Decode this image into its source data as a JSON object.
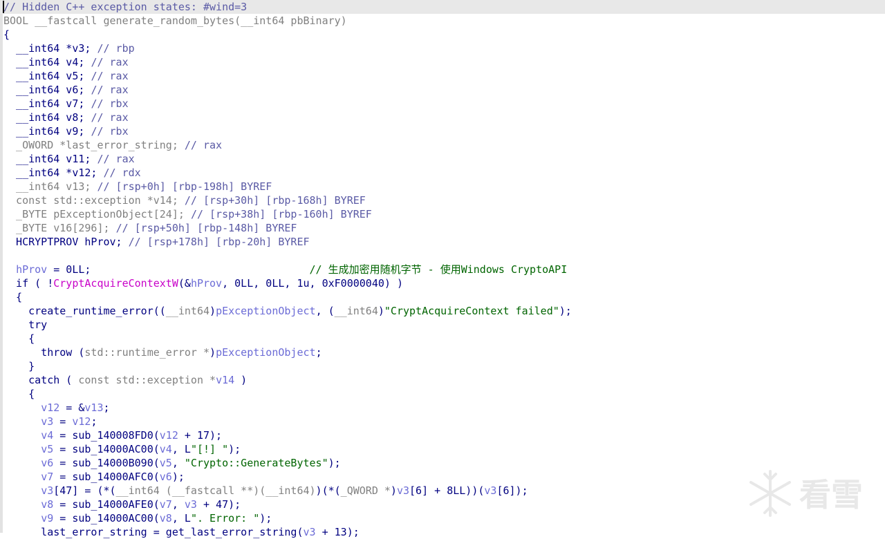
{
  "editor": {
    "lines": [
      [
        {
          "t": "// Hidden C++ exception states: #wind=3",
          "c": "cmt"
        }
      ],
      [
        {
          "t": "BOOL __fastcall generate_random_bytes(__int64 pbBinary)",
          "c": "gray"
        }
      ],
      [
        {
          "t": "{",
          "c": "plain"
        }
      ],
      [
        {
          "t": "  __int64 *v3; ",
          "c": "plain"
        },
        {
          "t": "// rbp",
          "c": "cmt"
        }
      ],
      [
        {
          "t": "  __int64 v4; ",
          "c": "plain"
        },
        {
          "t": "// rax",
          "c": "cmt"
        }
      ],
      [
        {
          "t": "  __int64 v5; ",
          "c": "plain"
        },
        {
          "t": "// rax",
          "c": "cmt"
        }
      ],
      [
        {
          "t": "  __int64 v6; ",
          "c": "plain"
        },
        {
          "t": "// rax",
          "c": "cmt"
        }
      ],
      [
        {
          "t": "  __int64 v7; ",
          "c": "plain"
        },
        {
          "t": "// rbx",
          "c": "cmt"
        }
      ],
      [
        {
          "t": "  __int64 v8; ",
          "c": "plain"
        },
        {
          "t": "// rax",
          "c": "cmt"
        }
      ],
      [
        {
          "t": "  __int64 v9; ",
          "c": "plain"
        },
        {
          "t": "// rbx",
          "c": "cmt"
        }
      ],
      [
        {
          "t": "  _OWORD *last_error_string; ",
          "c": "gray"
        },
        {
          "t": "// rax",
          "c": "cmt"
        }
      ],
      [
        {
          "t": "  __int64 v11; ",
          "c": "plain"
        },
        {
          "t": "// rax",
          "c": "cmt"
        }
      ],
      [
        {
          "t": "  __int64 *v12; ",
          "c": "plain"
        },
        {
          "t": "// rdx",
          "c": "cmt"
        }
      ],
      [
        {
          "t": "  __int64 v13; ",
          "c": "gray"
        },
        {
          "t": "// [rsp+0h] [rbp-198h] BYREF",
          "c": "cmt"
        }
      ],
      [
        {
          "t": "  const std::exception *v14; ",
          "c": "gray"
        },
        {
          "t": "// [rsp+30h] [rbp-168h] BYREF",
          "c": "cmt"
        }
      ],
      [
        {
          "t": "  _BYTE pExceptionObject[24]; ",
          "c": "gray"
        },
        {
          "t": "// [rsp+38h] [rbp-160h] BYREF",
          "c": "cmt"
        }
      ],
      [
        {
          "t": "  _BYTE v16[296]; ",
          "c": "gray"
        },
        {
          "t": "// [rsp+50h] [rbp-148h] BYREF",
          "c": "cmt"
        }
      ],
      [
        {
          "t": "  HCRYPTPROV hProv; ",
          "c": "plain"
        },
        {
          "t": "// [rsp+178h] [rbp-20h] BYREF",
          "c": "cmt"
        }
      ],
      [],
      [
        {
          "t": "  ",
          "c": "plain"
        },
        {
          "t": "hProv",
          "c": "var"
        },
        {
          "t": " = 0LL;                                   ",
          "c": "plain"
        },
        {
          "t": "// 生成加密用随机字节 - 使用Windows CryptoAPI",
          "c": "cmtg"
        }
      ],
      [
        {
          "t": "  if ( !",
          "c": "plain"
        },
        {
          "t": "CryptAcquireContextW",
          "c": "fn"
        },
        {
          "t": "(&",
          "c": "plain"
        },
        {
          "t": "hProv",
          "c": "var"
        },
        {
          "t": ", 0LL, 0LL, 1u, 0xF0000040) )",
          "c": "plain"
        }
      ],
      [
        {
          "t": "  {",
          "c": "plain"
        }
      ],
      [
        {
          "t": "    create_runtime_error((",
          "c": "plain"
        },
        {
          "t": "__int64",
          "c": "gray"
        },
        {
          "t": ")",
          "c": "plain"
        },
        {
          "t": "pExceptionObject",
          "c": "var"
        },
        {
          "t": ", (",
          "c": "plain"
        },
        {
          "t": "__int64",
          "c": "gray"
        },
        {
          "t": ")",
          "c": "plain"
        },
        {
          "t": "\"CryptAcquireContext failed\"",
          "c": "str"
        },
        {
          "t": ");",
          "c": "plain"
        }
      ],
      [
        {
          "t": "    try",
          "c": "plain"
        }
      ],
      [
        {
          "t": "    {",
          "c": "plain"
        }
      ],
      [
        {
          "t": "      throw (",
          "c": "plain"
        },
        {
          "t": "std::runtime_error *",
          "c": "gray"
        },
        {
          "t": ")",
          "c": "plain"
        },
        {
          "t": "pExceptionObject",
          "c": "var"
        },
        {
          "t": ";",
          "c": "plain"
        }
      ],
      [
        {
          "t": "    }",
          "c": "plain"
        }
      ],
      [
        {
          "t": "    catch ( ",
          "c": "plain"
        },
        {
          "t": "const std::exception *",
          "c": "gray"
        },
        {
          "t": "v14",
          "c": "var"
        },
        {
          "t": " )",
          "c": "plain"
        }
      ],
      [
        {
          "t": "    {",
          "c": "plain"
        }
      ],
      [
        {
          "t": "      ",
          "c": "plain"
        },
        {
          "t": "v12",
          "c": "var"
        },
        {
          "t": " = &",
          "c": "plain"
        },
        {
          "t": "v13",
          "c": "var"
        },
        {
          "t": ";",
          "c": "plain"
        }
      ],
      [
        {
          "t": "      ",
          "c": "plain"
        },
        {
          "t": "v3",
          "c": "var"
        },
        {
          "t": " = ",
          "c": "plain"
        },
        {
          "t": "v12",
          "c": "var"
        },
        {
          "t": ";",
          "c": "plain"
        }
      ],
      [
        {
          "t": "      ",
          "c": "plain"
        },
        {
          "t": "v4",
          "c": "var"
        },
        {
          "t": " = sub_140008FD0(",
          "c": "plain"
        },
        {
          "t": "v12",
          "c": "var"
        },
        {
          "t": " + 17);",
          "c": "plain"
        }
      ],
      [
        {
          "t": "      ",
          "c": "plain"
        },
        {
          "t": "v5",
          "c": "var"
        },
        {
          "t": " = sub_14000AC00(",
          "c": "plain"
        },
        {
          "t": "v4",
          "c": "var"
        },
        {
          "t": ", L",
          "c": "plain"
        },
        {
          "t": "\"[!] \"",
          "c": "str"
        },
        {
          "t": ");",
          "c": "plain"
        }
      ],
      [
        {
          "t": "      ",
          "c": "plain"
        },
        {
          "t": "v6",
          "c": "var"
        },
        {
          "t": " = sub_14000B090(",
          "c": "plain"
        },
        {
          "t": "v5",
          "c": "var"
        },
        {
          "t": ", ",
          "c": "plain"
        },
        {
          "t": "\"Crypto::GenerateBytes\"",
          "c": "str"
        },
        {
          "t": ");",
          "c": "plain"
        }
      ],
      [
        {
          "t": "      ",
          "c": "plain"
        },
        {
          "t": "v7",
          "c": "var"
        },
        {
          "t": " = sub_14000AFC0(",
          "c": "plain"
        },
        {
          "t": "v6",
          "c": "var"
        },
        {
          "t": ");",
          "c": "plain"
        }
      ],
      [
        {
          "t": "      ",
          "c": "plain"
        },
        {
          "t": "v3",
          "c": "var"
        },
        {
          "t": "[47] = (*(",
          "c": "plain"
        },
        {
          "t": "__int64 (__fastcall **)(__int64)",
          "c": "gray"
        },
        {
          "t": ")(*(",
          "c": "plain"
        },
        {
          "t": "_QWORD *",
          "c": "gray"
        },
        {
          "t": ")",
          "c": "plain"
        },
        {
          "t": "v3",
          "c": "var"
        },
        {
          "t": "[6] + 8LL))(",
          "c": "plain"
        },
        {
          "t": "v3",
          "c": "var"
        },
        {
          "t": "[6]);",
          "c": "plain"
        }
      ],
      [
        {
          "t": "      ",
          "c": "plain"
        },
        {
          "t": "v8",
          "c": "var"
        },
        {
          "t": " = sub_14000AFE0(",
          "c": "plain"
        },
        {
          "t": "v7",
          "c": "var"
        },
        {
          "t": ", ",
          "c": "plain"
        },
        {
          "t": "v3",
          "c": "var"
        },
        {
          "t": " + 47);",
          "c": "plain"
        }
      ],
      [
        {
          "t": "      ",
          "c": "plain"
        },
        {
          "t": "v9",
          "c": "var"
        },
        {
          "t": " = sub_14000AC00(",
          "c": "plain"
        },
        {
          "t": "v8",
          "c": "var"
        },
        {
          "t": ", L",
          "c": "plain"
        },
        {
          "t": "\". Error: \"",
          "c": "str"
        },
        {
          "t": ");",
          "c": "plain"
        }
      ],
      [
        {
          "t": "      last_error_string = get_last_error_string(",
          "c": "plain"
        },
        {
          "t": "v3",
          "c": "var"
        },
        {
          "t": " + 13);",
          "c": "plain"
        }
      ]
    ]
  },
  "watermark": {
    "icon": "snowflake-logo-icon",
    "text": "看雪",
    "color": "#9a9a9a"
  }
}
